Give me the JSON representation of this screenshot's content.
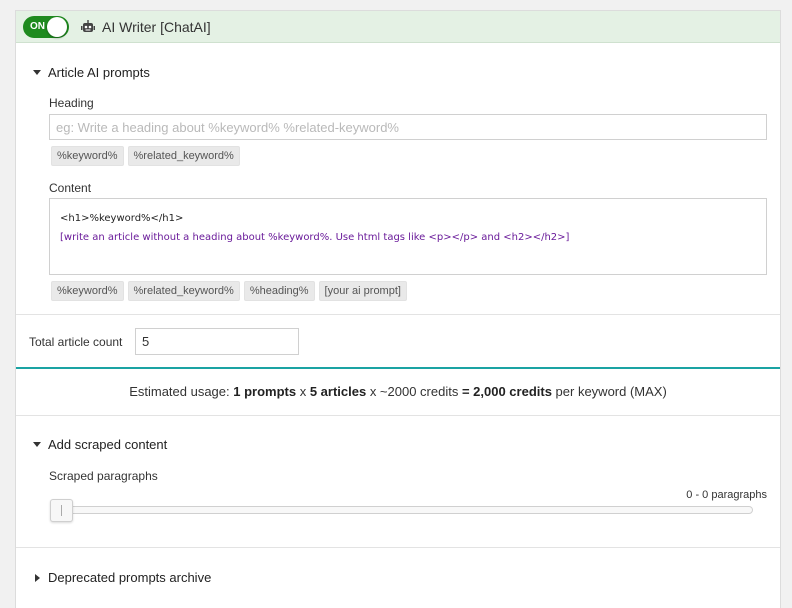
{
  "header": {
    "toggle_label": "ON",
    "title": "AI Writer [ChatAI]"
  },
  "article_prompts": {
    "section_title": "Article AI prompts",
    "heading_label": "Heading",
    "heading_placeholder": "eg: Write a heading about %keyword% %related-keyword%",
    "heading_tags": [
      "%keyword%",
      "%related_keyword%"
    ],
    "content_label": "Content",
    "content_line1": "<h1>%keyword%</h1>",
    "content_line2": "[write an article without a heading about %keyword%. Use html tags like <p></p> and <h2></h2>]",
    "content_tags": [
      "%keyword%",
      "%related_keyword%",
      "%heading%",
      "[your ai prompt]"
    ]
  },
  "article_count": {
    "label": "Total article count",
    "value": "5"
  },
  "usage": {
    "prefix": "Estimated usage: ",
    "prompts": "1 prompts",
    "times1": " x ",
    "articles": "5 articles",
    "times2": " x ~2000 credits ",
    "equals": "= 2,000 credits",
    "suffix": " per keyword (MAX)"
  },
  "scraped": {
    "section_title": "Add scraped content",
    "paragraphs_label": "Scraped paragraphs",
    "range_text": "0 - 0 paragraphs",
    "slider_value": 0
  },
  "deprecated": {
    "section_title": "Deprecated prompts archive"
  }
}
